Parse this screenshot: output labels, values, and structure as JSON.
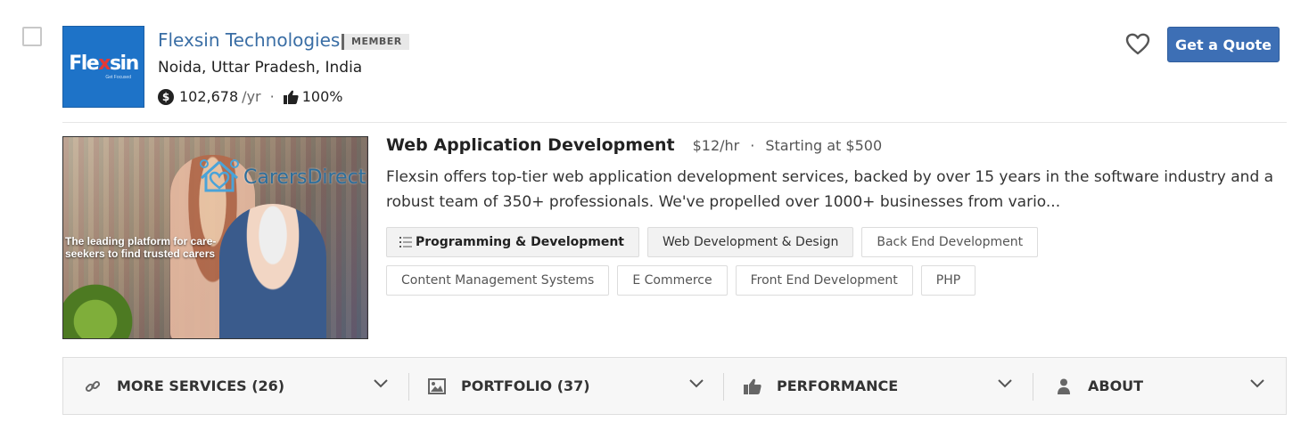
{
  "listing": {
    "company_name": "Flexsin Technologies",
    "badge": "MEMBER",
    "location": "Noida, Uttar Pradesh, India",
    "revenue": "102,678",
    "revenue_unit": "/yr",
    "rating_separator": "·",
    "recommend_pct": "100%",
    "quote_button": "Get a Quote",
    "logo_word_a": "Fle",
    "logo_word_x": "x",
    "logo_word_b": "sin",
    "logo_tagline": "Get Focused"
  },
  "service": {
    "title": "Web Application Development",
    "rate": "$12/hr",
    "separator": "·",
    "min_project": "Starting at $500",
    "description": "Flexsin offers top-tier web application development services, backed by over 15 years in the software industry and a robust team of 350+ professionals. We've propelled over 1000+ businesses from vario...",
    "image_brand": "CarersDirect",
    "image_caption": "The leading platform for care-seekers to find trusted carers"
  },
  "tags": [
    "Programming & Development",
    "Web Development & Design",
    "Back End Development",
    "Content Management Systems",
    "E Commerce",
    "Front End Development",
    "PHP"
  ],
  "sections": {
    "more_services": "MORE SERVICES (26)",
    "portfolio": "PORTFOLIO (37)",
    "performance": "PERFORMANCE",
    "about": "ABOUT"
  },
  "icons": {
    "coin": "dollar-coin-icon",
    "thumb": "thumbs-up-icon",
    "heart": "heart-outline-icon",
    "link": "link-icon",
    "image": "image-icon",
    "person": "person-icon",
    "chevron": "chevron-down-icon",
    "list": "list-icon"
  },
  "colors": {
    "accent": "#3d6fb5",
    "company_link": "#3a6ea5",
    "logo_bg": "#1e73c8"
  }
}
